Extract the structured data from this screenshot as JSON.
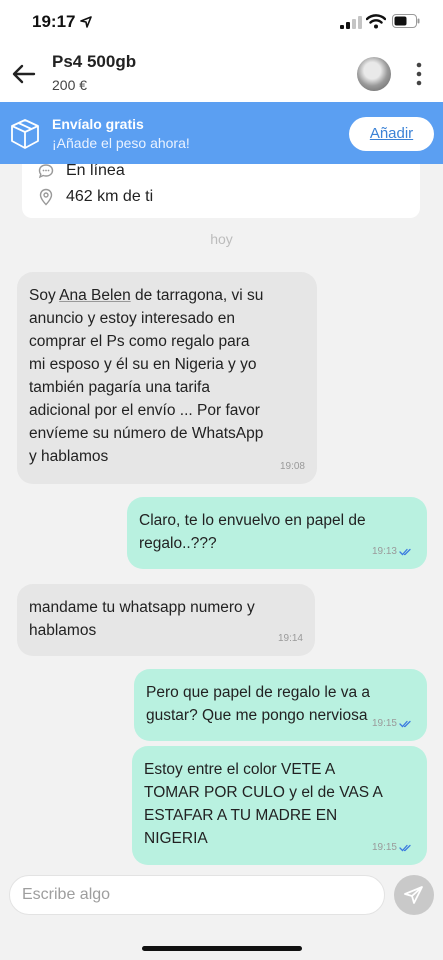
{
  "status_bar": {
    "time": "19:17"
  },
  "header": {
    "title": "Ps4 500gb",
    "price": "200 €"
  },
  "banner": {
    "title": "Envíalo gratis",
    "subtitle": "¡Añade el peso ahora!",
    "button": "Añadir"
  },
  "info_card": {
    "status": "En línea",
    "distance": "462 km de ti"
  },
  "day_label": "hoy",
  "messages": [
    {
      "direction": "in",
      "time": "19:08",
      "text_before": "Soy ",
      "text_underlined": "Ana Belen",
      "text_after": " de tarragona, vi su\nanuncio y estoy interesado en\ncomprar el Ps como regalo para\nmi esposo y él su en Nigeria y yo\ntambién pagaría una tarifa\nadicional por el envío ... Por favor\nenvíeme su número de WhatsApp\ny hablamos"
    },
    {
      "direction": "out",
      "time": "19:13",
      "text": "Claro, te lo envuelvo en papel de\nregalo..???"
    },
    {
      "direction": "in",
      "time": "19:14",
      "text": "mandame tu whatsapp numero y\nhablamos"
    },
    {
      "direction": "out",
      "time": "19:15",
      "text": "Pero que papel de regalo le va a\ngustar? Que me pongo nerviosa"
    },
    {
      "direction": "out",
      "time": "19:15",
      "text": "Estoy entre el color VETE A\nTOMAR POR CULO y el de VAS A\nESTAFAR A TU MADRE EN\nNIGERIA"
    }
  ],
  "input": {
    "placeholder": "Escribe algo"
  },
  "colors": {
    "banner": "#5b9ff2",
    "incoming": "#e6e6e6",
    "outgoing": "#b9f1e0",
    "read_ticks": "#3b7be0"
  },
  "icons": [
    "location-arrow-icon",
    "signal-icon",
    "wifi-icon",
    "battery-icon",
    "back-arrow-icon",
    "more-vertical-icon",
    "box-icon",
    "chat-bubble-icon",
    "location-pin-icon",
    "double-check-icon",
    "send-icon"
  ]
}
